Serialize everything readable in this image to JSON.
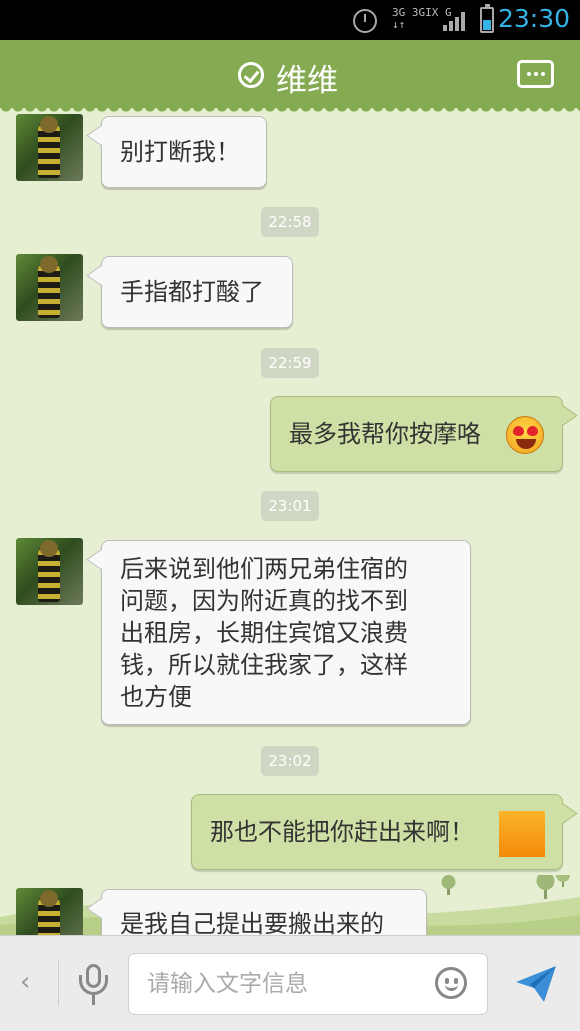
{
  "status_bar": {
    "time": "23:30",
    "network_line1": "3G 3GIX G",
    "network_line2": "↓↑"
  },
  "header": {
    "title": "维维"
  },
  "messages": [
    {
      "kind": "in",
      "text": "别打断我！"
    },
    {
      "kind": "time",
      "text": "22:58"
    },
    {
      "kind": "in",
      "text": "手指都打酸了"
    },
    {
      "kind": "time",
      "text": "22:59"
    },
    {
      "kind": "out",
      "text": "最多我帮你按摩咯",
      "emoji": "heart-eyes-emoji"
    },
    {
      "kind": "time",
      "text": "23:01"
    },
    {
      "kind": "in",
      "lines": [
        "后来说到他们两兄弟住宿的",
        "问题，因为附近真的找不到",
        "出租房，长期住宾馆又浪费",
        "钱，所以就住我家了，这样",
        "也方便"
      ]
    },
    {
      "kind": "time",
      "text": "23:02"
    },
    {
      "kind": "out",
      "text": "那也不能把你赶出来啊！",
      "emoji": "orange-square-emoji"
    },
    {
      "kind": "in",
      "text": "是我自己提出要搬出来的"
    }
  ],
  "input": {
    "placeholder": "请输入文字信息",
    "value": ""
  },
  "colors": {
    "title_bar": "#85ab52",
    "chat_bg": "#e6efd2",
    "outgoing_bubble": "#cfe0a6",
    "incoming_bubble": "#f8f8f8",
    "status_time": "#35b2e6",
    "send_icon": "#3a8fd6"
  }
}
